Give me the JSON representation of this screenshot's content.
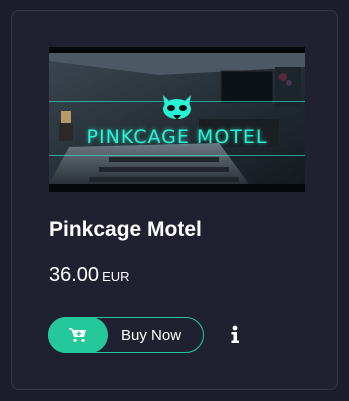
{
  "product": {
    "image_text": "PINKCAGE MOTEL",
    "title": "Pinkcage Motel",
    "price_amount": "36.00",
    "price_currency": "EUR"
  },
  "actions": {
    "buy_label": "Buy Now",
    "cart_icon": "cart-icon",
    "info_icon": "info-icon"
  },
  "colors": {
    "accent": "#24c89a",
    "background": "#1b1d2a",
    "logo": "#28f3d6"
  }
}
